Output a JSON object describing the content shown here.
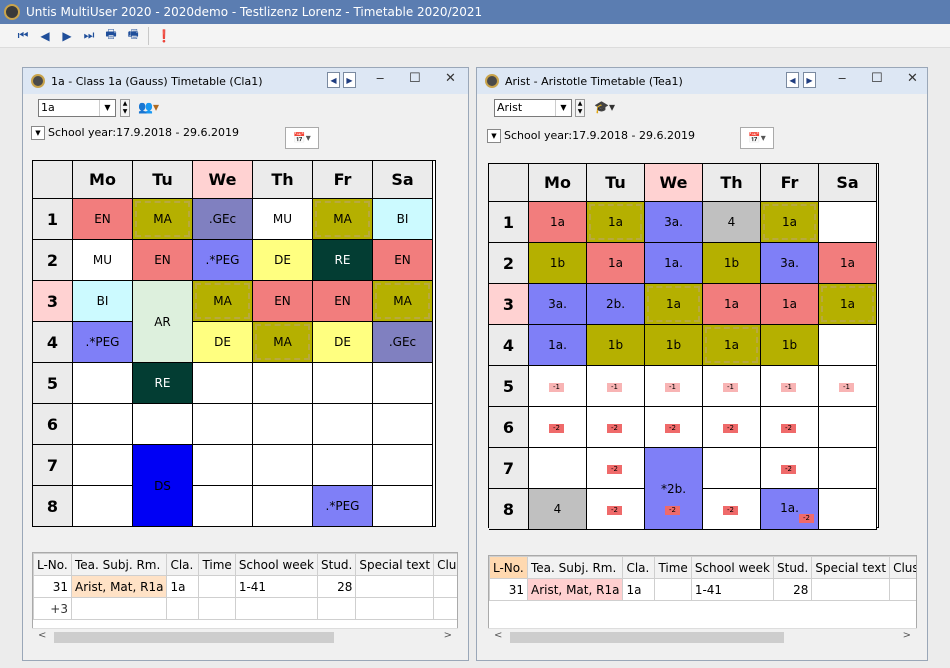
{
  "app": {
    "title": "Untis MultiUser 2020 - 2020demo  -  Testlizenz Lorenz     -     Timetable 2020/2021"
  },
  "toolbar": {
    "icons": [
      "first-icon",
      "prev-icon",
      "next-icon",
      "last-icon",
      "print-icon",
      "print-preview-icon",
      "alert-icon"
    ],
    "glyphs": [
      "⏮",
      "◀",
      "▶",
      "⏭",
      "🖶",
      "🖷",
      "❗"
    ]
  },
  "colors": {
    "pink": "#f27d7d",
    "olive": "#b5b000",
    "lavender": "#8080c0",
    "violet": "#7f7ff7",
    "lightcyan": "#ccfaff",
    "lightyellow": "#ffff80",
    "darkteal": "#033d33",
    "mint": "#ddf0dd",
    "blue": "#0000f5",
    "gray": "#c0c0c0",
    "wedhead": "#ffd2d2"
  },
  "left": {
    "title": "1a - Class 1a (Gauss)  Timetable  (Cla1)",
    "selector_value": "1a",
    "year": "School year:17.9.2018 - 29.6.2019",
    "days": [
      "Mo",
      "Tu",
      "We",
      "Th",
      "Fr",
      "Sa"
    ],
    "periods": [
      "1",
      "2",
      "3",
      "4",
      "5",
      "6",
      "7",
      "8"
    ],
    "lessons": [
      {
        "d": 0,
        "p": 0,
        "s": 1,
        "t": "EN",
        "bg": "#f27d7d",
        "fg": "#000"
      },
      {
        "d": 1,
        "p": 0,
        "s": 1,
        "t": "MA",
        "bg": "#b5b000",
        "fg": "#000",
        "cur": true
      },
      {
        "d": 2,
        "p": 0,
        "s": 1,
        "t": ".GEc",
        "bg": "#8080c0",
        "fg": "#000"
      },
      {
        "d": 3,
        "p": 0,
        "s": 1,
        "t": "MU",
        "bg": "#ffffff",
        "fg": "#000"
      },
      {
        "d": 4,
        "p": 0,
        "s": 1,
        "t": "MA",
        "bg": "#b5b000",
        "fg": "#000",
        "cur": true
      },
      {
        "d": 5,
        "p": 0,
        "s": 1,
        "t": "BI",
        "bg": "#ccfaff",
        "fg": "#000"
      },
      {
        "d": 0,
        "p": 1,
        "s": 1,
        "t": "MU",
        "bg": "#ffffff",
        "fg": "#000"
      },
      {
        "d": 1,
        "p": 1,
        "s": 1,
        "t": "EN",
        "bg": "#f27d7d",
        "fg": "#000"
      },
      {
        "d": 2,
        "p": 1,
        "s": 1,
        "t": ".*PEG",
        "bg": "#7f7ff7",
        "fg": "#000"
      },
      {
        "d": 3,
        "p": 1,
        "s": 1,
        "t": "DE",
        "bg": "#ffff80",
        "fg": "#000"
      },
      {
        "d": 4,
        "p": 1,
        "s": 1,
        "t": "RE",
        "bg": "#033d33",
        "fg": "#ffffff"
      },
      {
        "d": 5,
        "p": 1,
        "s": 1,
        "t": "EN",
        "bg": "#f27d7d",
        "fg": "#000"
      },
      {
        "d": 0,
        "p": 2,
        "s": 1,
        "t": "BI",
        "bg": "#ccfaff",
        "fg": "#000"
      },
      {
        "d": 1,
        "p": 2,
        "s": 2,
        "t": "AR",
        "bg": "#ddf0dd",
        "fg": "#000"
      },
      {
        "d": 2,
        "p": 2,
        "s": 1,
        "t": "MA",
        "bg": "#b5b000",
        "fg": "#000",
        "cur": true
      },
      {
        "d": 3,
        "p": 2,
        "s": 1,
        "t": "EN",
        "bg": "#f27d7d",
        "fg": "#000"
      },
      {
        "d": 4,
        "p": 2,
        "s": 1,
        "t": "EN",
        "bg": "#f27d7d",
        "fg": "#000"
      },
      {
        "d": 5,
        "p": 2,
        "s": 1,
        "t": "MA",
        "bg": "#b5b000",
        "fg": "#000",
        "cur": true
      },
      {
        "d": 0,
        "p": 3,
        "s": 1,
        "t": ".*PEG",
        "bg": "#7f7ff7",
        "fg": "#000"
      },
      {
        "d": 2,
        "p": 3,
        "s": 1,
        "t": "DE",
        "bg": "#ffff80",
        "fg": "#000"
      },
      {
        "d": 3,
        "p": 3,
        "s": 1,
        "t": "MA",
        "bg": "#b5b000",
        "fg": "#000",
        "cur": true
      },
      {
        "d": 4,
        "p": 3,
        "s": 1,
        "t": "DE",
        "bg": "#ffff80",
        "fg": "#000"
      },
      {
        "d": 5,
        "p": 3,
        "s": 1,
        "t": ".GEc",
        "bg": "#8080c0",
        "fg": "#000"
      },
      {
        "d": 1,
        "p": 4,
        "s": 1,
        "t": "RE",
        "bg": "#033d33",
        "fg": "#ffffff"
      },
      {
        "d": 1,
        "p": 6,
        "s": 2,
        "t": "DS",
        "bg": "#0000f5",
        "fg": "#000"
      },
      {
        "d": 4,
        "p": 7,
        "s": 1,
        "t": ".*PEG",
        "bg": "#7f7ff7",
        "fg": "#000"
      }
    ],
    "table": {
      "headers": [
        "L-No.",
        "Tea. Subj. Rm.",
        "Cla.",
        "Time",
        "School week",
        "Stud.",
        "Special text",
        "Cluste"
      ],
      "rows": [
        [
          "31",
          "Arist, Mat, R1a",
          "1a",
          "",
          "1-41",
          "28",
          "",
          ""
        ],
        [
          "+3",
          "",
          "",
          "",
          "",
          "",
          "",
          ""
        ]
      ]
    }
  },
  "right": {
    "title": "Arist - Aristotle  Timetable  (Tea1)",
    "selector_value": "Arist",
    "year": "School year:17.9.2018 - 29.6.2019",
    "days": [
      "Mo",
      "Tu",
      "We",
      "Th",
      "Fr",
      "Sa"
    ],
    "periods": [
      "1",
      "2",
      "3",
      "4",
      "5",
      "6",
      "7",
      "8"
    ],
    "lessons": [
      {
        "d": 0,
        "p": 0,
        "s": 1,
        "t": "1a",
        "bg": "#f27d7d",
        "fg": "#000"
      },
      {
        "d": 1,
        "p": 0,
        "s": 1,
        "t": "1a",
        "bg": "#b5b000",
        "fg": "#000",
        "cur": true
      },
      {
        "d": 2,
        "p": 0,
        "s": 1,
        "t": "3a.",
        "bg": "#7f7ff7",
        "fg": "#000"
      },
      {
        "d": 3,
        "p": 0,
        "s": 1,
        "t": "4",
        "bg": "#c0c0c0",
        "fg": "#000"
      },
      {
        "d": 4,
        "p": 0,
        "s": 1,
        "t": "1a",
        "bg": "#b5b000",
        "fg": "#000",
        "cur": true
      },
      {
        "d": 0,
        "p": 1,
        "s": 1,
        "t": "1b",
        "bg": "#b5b000",
        "fg": "#000"
      },
      {
        "d": 1,
        "p": 1,
        "s": 1,
        "t": "1a",
        "bg": "#f27d7d",
        "fg": "#000"
      },
      {
        "d": 2,
        "p": 1,
        "s": 1,
        "t": "1a.",
        "bg": "#7f7ff7",
        "fg": "#000"
      },
      {
        "d": 3,
        "p": 1,
        "s": 1,
        "t": "1b",
        "bg": "#b5b000",
        "fg": "#000"
      },
      {
        "d": 4,
        "p": 1,
        "s": 1,
        "t": "3a.",
        "bg": "#7f7ff7",
        "fg": "#000"
      },
      {
        "d": 5,
        "p": 1,
        "s": 1,
        "t": "1a",
        "bg": "#f27d7d",
        "fg": "#000"
      },
      {
        "d": 0,
        "p": 2,
        "s": 1,
        "t": "3a.",
        "bg": "#7f7ff7",
        "fg": "#000"
      },
      {
        "d": 1,
        "p": 2,
        "s": 1,
        "t": "2b.",
        "bg": "#7f7ff7",
        "fg": "#000"
      },
      {
        "d": 2,
        "p": 2,
        "s": 1,
        "t": "1a",
        "bg": "#b5b000",
        "fg": "#000",
        "cur": true
      },
      {
        "d": 3,
        "p": 2,
        "s": 1,
        "t": "1a",
        "bg": "#f27d7d",
        "fg": "#000"
      },
      {
        "d": 4,
        "p": 2,
        "s": 1,
        "t": "1a",
        "bg": "#f27d7d",
        "fg": "#000"
      },
      {
        "d": 5,
        "p": 2,
        "s": 1,
        "t": "1a",
        "bg": "#b5b000",
        "fg": "#000",
        "cur": true
      },
      {
        "d": 0,
        "p": 3,
        "s": 1,
        "t": "1a.",
        "bg": "#7f7ff7",
        "fg": "#000"
      },
      {
        "d": 1,
        "p": 3,
        "s": 1,
        "t": "1b",
        "bg": "#b5b000",
        "fg": "#000"
      },
      {
        "d": 2,
        "p": 3,
        "s": 1,
        "t": "1b",
        "bg": "#b5b000",
        "fg": "#000"
      },
      {
        "d": 3,
        "p": 3,
        "s": 1,
        "t": "1a",
        "bg": "#b5b000",
        "fg": "#000",
        "cur": true
      },
      {
        "d": 4,
        "p": 3,
        "s": 1,
        "t": "1b",
        "bg": "#b5b000",
        "fg": "#000"
      },
      {
        "d": 2,
        "p": 6,
        "s": 2,
        "t": "*2b.",
        "bg": "#7f7ff7",
        "fg": "#000"
      },
      {
        "d": 0,
        "p": 7,
        "s": 1,
        "t": "4",
        "bg": "#c0c0c0",
        "fg": "#000"
      },
      {
        "d": 4,
        "p": 7,
        "s": 1,
        "t": "1a.",
        "bg": "#7f7ff7",
        "fg": "#000"
      }
    ],
    "mini": [
      {
        "d": 0,
        "p": 4,
        "t": "-1",
        "bg": "#f8b4b4"
      },
      {
        "d": 1,
        "p": 4,
        "t": "-1",
        "bg": "#f8b4b4"
      },
      {
        "d": 2,
        "p": 4,
        "t": "-1",
        "bg": "#f8b4b4"
      },
      {
        "d": 3,
        "p": 4,
        "t": "-1",
        "bg": "#f8b4b4"
      },
      {
        "d": 4,
        "p": 4,
        "t": "-1",
        "bg": "#f8b4b4"
      },
      {
        "d": 5,
        "p": 4,
        "t": "-1",
        "bg": "#f8b4b4"
      },
      {
        "d": 0,
        "p": 5,
        "t": "-2",
        "bg": "#ef6a6a"
      },
      {
        "d": 1,
        "p": 5,
        "t": "-2",
        "bg": "#ef6a6a"
      },
      {
        "d": 2,
        "p": 5,
        "t": "-2",
        "bg": "#ef6a6a"
      },
      {
        "d": 3,
        "p": 5,
        "t": "-2",
        "bg": "#ef6a6a"
      },
      {
        "d": 4,
        "p": 5,
        "t": "-2",
        "bg": "#ef6a6a"
      },
      {
        "d": 1,
        "p": 6,
        "t": "-2",
        "bg": "#ef6a6a"
      },
      {
        "d": 4,
        "p": 6,
        "t": "-2",
        "bg": "#ef6a6a"
      },
      {
        "d": 1,
        "p": 7,
        "t": "-2",
        "bg": "#ef6a6a"
      },
      {
        "d": 2,
        "p": 7,
        "t": "-2",
        "bg": "#ef6a6a"
      },
      {
        "d": 3,
        "p": 7,
        "t": "-2",
        "bg": "#ef6a6a"
      },
      {
        "d": 4,
        "p": 7,
        "t": "-2",
        "bg": "#ef6a6a"
      }
    ],
    "table": {
      "headers": [
        "L-No.",
        "Tea. Subj. Rm.",
        "Cla.",
        "Time",
        "School week",
        "Stud.",
        "Special text",
        "Cluste"
      ],
      "rows": [
        [
          "31",
          "Arist, Mat, R1a",
          "1a",
          "",
          "1-41",
          "28",
          "",
          ""
        ]
      ]
    }
  }
}
